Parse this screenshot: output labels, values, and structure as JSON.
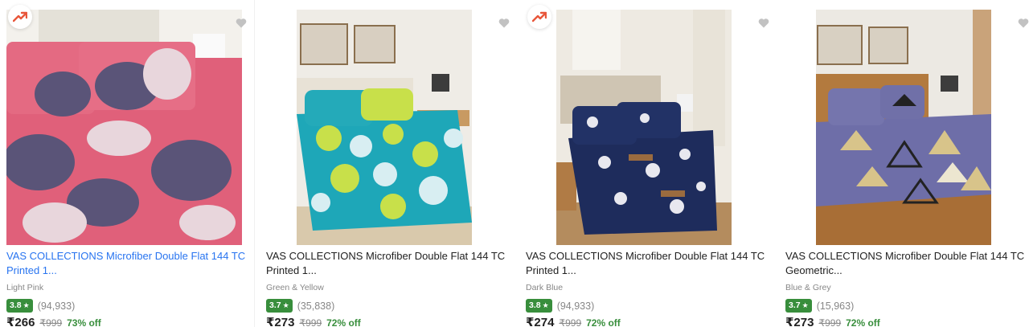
{
  "products": [
    {
      "title": "VAS COLLECTIONS Microfiber Double Flat 144 TC Printed 1...",
      "subtitle": "Light Pink",
      "rating": "3.8",
      "reviews": "(94,933)",
      "price": "₹266",
      "mrp": "₹999",
      "discount": "73% off",
      "trending": true,
      "colors": {
        "sheet": "#e0607a",
        "pattern": "#5a5478",
        "wall": "#ecebe6"
      }
    },
    {
      "title": "VAS COLLECTIONS Microfiber Double Flat 144 TC Printed 1...",
      "subtitle": "Green & Yellow",
      "rating": "3.7",
      "reviews": "(35,838)",
      "price": "₹273",
      "mrp": "₹999",
      "discount": "72% off",
      "trending": false,
      "colors": {
        "sheet": "#1ea7b8",
        "pattern": "#c8e04a",
        "wall": "#efece6"
      }
    },
    {
      "title": "VAS COLLECTIONS Microfiber Double Flat 144 TC Printed 1...",
      "subtitle": "Dark Blue",
      "rating": "3.8",
      "reviews": "(94,933)",
      "price": "₹274",
      "mrp": "₹999",
      "discount": "72% off",
      "trending": true,
      "colors": {
        "sheet": "#1e2c5c",
        "pattern": "#e8e8ef",
        "wall": "#eeeae2"
      }
    },
    {
      "title": "VAS COLLECTIONS Microfiber Double Flat 144 TC Geometric...",
      "subtitle": "Blue & Grey",
      "rating": "3.7",
      "reviews": "(15,963)",
      "price": "₹273",
      "mrp": "₹999",
      "discount": "72% off",
      "trending": false,
      "colors": {
        "sheet": "#6e6ea8",
        "pattern": "#d8c48a",
        "wall": "#ece9e3"
      }
    }
  ],
  "icons": {
    "wishlist": "heart-icon",
    "trending": "trending-up-icon",
    "rating_star": "star-icon"
  },
  "theme": {
    "accent": "#2874f0",
    "rating_green": "#388e3c",
    "muted": "#878787"
  }
}
